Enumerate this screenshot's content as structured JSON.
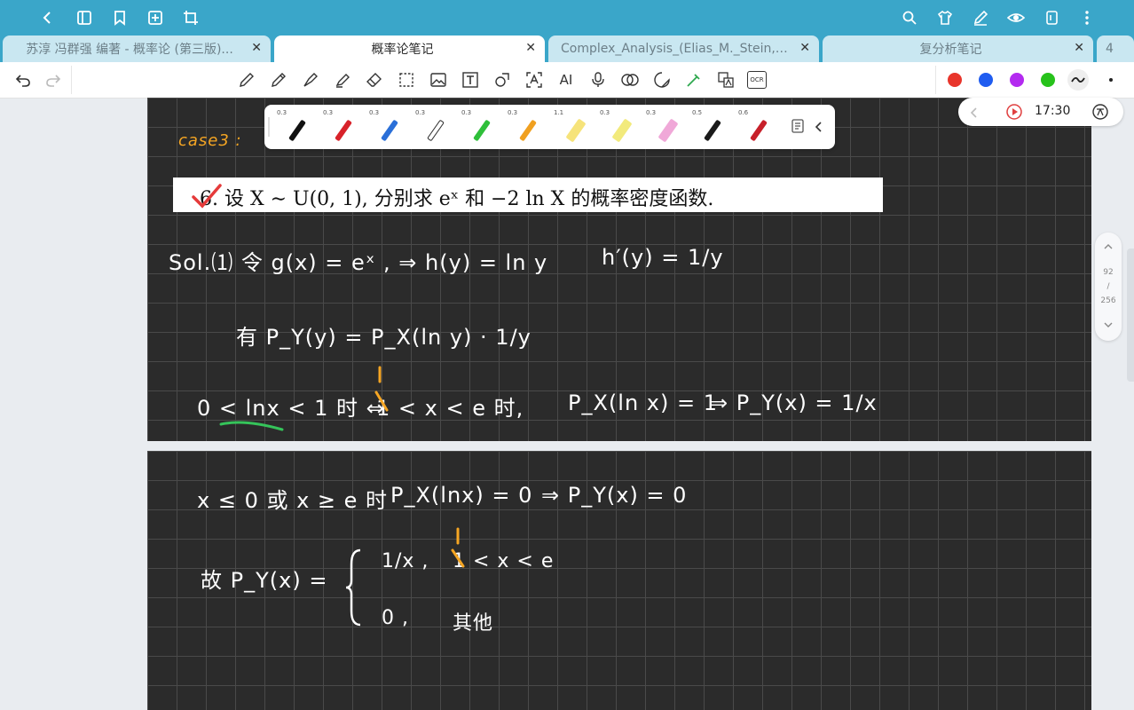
{
  "appbar": {
    "back_icon": "chevron-left-icon",
    "right_icons": [
      "search-icon",
      "shirt-icon",
      "pen-edit-icon",
      "eye-icon",
      "page-icon",
      "more-vertical-icon"
    ]
  },
  "tabs": [
    {
      "label": "苏淳 冯群强 编著 - 概率论 (第三版)...",
      "active": false
    },
    {
      "label": "概率论笔记",
      "active": true
    },
    {
      "label": "Complex_Analysis_(Elias_M._Stein,_...",
      "active": false
    },
    {
      "label": "复分析笔记",
      "active": false
    },
    {
      "label": "4",
      "active": false
    }
  ],
  "toolbar": {
    "ai_label": "AI",
    "ocr_label": "OCR",
    "colors": [
      "#e8352b",
      "#1f5cf0",
      "#b32af0",
      "#27c21b"
    ]
  },
  "palette": {
    "pens": [
      {
        "size": "0.3",
        "color": "#111111"
      },
      {
        "size": "0.3",
        "color": "#d8222a"
      },
      {
        "size": "0.3",
        "color": "#2a6fd8"
      },
      {
        "size": "0.3",
        "color": "#333333"
      },
      {
        "size": "0.3",
        "color": "#2fbf3a"
      },
      {
        "size": "0.3",
        "color": "#f0a020"
      },
      {
        "size": "1.1",
        "color": "#f6e37a"
      },
      {
        "size": "0.3",
        "color": "#f2ea7c"
      },
      {
        "size": "0.3",
        "color": "#f0a8d8"
      },
      {
        "size": "0.5",
        "color": "#1a1a1a"
      },
      {
        "size": "0.6",
        "color": "#c7202a"
      }
    ]
  },
  "timer": {
    "time": "17:30"
  },
  "scroller": {
    "current": "92",
    "slash": "/",
    "total": "256"
  },
  "note": {
    "case_label": "case3 :",
    "problem_text": "6. 设 X ∼ U(0, 1), 分别求 eˣ 和 −2 ln X 的概率密度函数.",
    "line1": "Sol.⑴ 令 g(x) = eˣ ,  ⇒ h(y) = ln y",
    "line1b": "h′(y) = 1/y",
    "line2": "有 P_Y(y) = P_X(ln y) · 1/y",
    "line3a": "0 < lnx < 1 时 ⇔ ",
    "line3b": "1 < x < e 时,",
    "line3c": "P_X(ln x) = 1",
    "line3d": "⇒ P_Y(x) = 1/x",
    "line4a": "x ≤ 0 或 x ≥ e 时",
    "line4b": "P_X(lnx) = 0",
    "line4c": "⇒ P_Y(x) = 0",
    "line5a": "故 P_Y(x) =",
    "case1_val": "1/x ,",
    "case1_cond": "1 < x < e",
    "case2_val": "0 ,",
    "case2_cond": "其他"
  }
}
